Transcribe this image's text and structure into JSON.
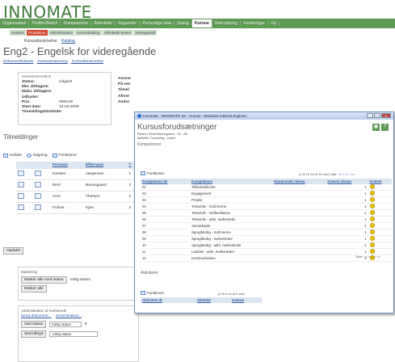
{
  "app": {
    "logo": "INNOMATE"
  },
  "mainnav": [
    "Organisation",
    "Profiler/Match",
    "Kompetencer",
    "Aktiviteter",
    "Rapporter",
    "Personlige data",
    "Dialog",
    "Kursus",
    "Rekruttering",
    "Vurderinger",
    "Op"
  ],
  "mainnav_active": "Kursus",
  "subnav": [
    "Analyse",
    "Produktion",
    "Administration",
    "Kursuskatalog",
    "Afsluttede kurser",
    "Ventegekald"
  ],
  "subnav_active": "Produktion",
  "crumbs": {
    "current": "Kursusbeskrivelse",
    "link": "Katalog"
  },
  "page": {
    "title": "Eng2 - Engelsk for videregående",
    "links": [
      "Dokumenthistorie",
      "Kursusevaluering",
      "Kursusbeskrivelse"
    ]
  },
  "info": {
    "legend": "Kursusinformation",
    "rows": [
      {
        "label": "Status:",
        "value": "Udgivet"
      },
      {
        "label": "Min. deltagere:",
        "value": ""
      },
      {
        "label": "Maks. deltagere:",
        "value": ""
      },
      {
        "label": "Udbyder:",
        "value": ""
      },
      {
        "label": "Pris:",
        "value": "2000,50"
      },
      {
        "label": "Start dato:",
        "value": "12-02-2009"
      },
      {
        "label": "Timeoldings/Institute:",
        "value": ""
      }
    ],
    "right": [
      "Ansvar",
      "På ven",
      "Tilmel",
      "Afrest",
      "Andre"
    ]
  },
  "timeslots": {
    "title": "Tilmeldinger",
    "toolbar": [
      "Indsæt",
      "Søgning",
      "Funktioner"
    ],
    "headers": [
      "",
      "",
      "Fornavn",
      "Efternavn",
      "T"
    ],
    "rows": [
      [
        "Karsten",
        "Jørgensen",
        "1"
      ],
      [
        "Bent",
        "Baunsgaard",
        "2"
      ],
      [
        "Anni",
        "Thorsen",
        "1"
      ],
      [
        "Folmer",
        "Kjær",
        "2"
      ]
    ],
    "update": "Opdatér"
  },
  "marking": {
    "legend": "Markering",
    "btn1": "Markér alle med status",
    "status": "Vælg status",
    "btn2": "Markér alle"
  },
  "admin": {
    "legend": "Administration af markerede",
    "links": [
      "Send dokument...",
      "Send besked..."
    ],
    "set_status": "Sæt status",
    "status": "Vælg status",
    "delete": "Slet/Afbryd",
    "status2": "Vælg status"
  },
  "popup": {
    "title": "Innomate - INNOMATE a/s - Kursus - Windows Internet Explorer",
    "heading": "Kursusforudsætninger",
    "sub1": "Person: Bent Baunsgaard - 26 - 88",
    "sub2": "Aktivitet: Coaching - coach",
    "section1": "Kompetencer",
    "functions": "Funktioner",
    "info_top": "(1 til 15 ud af 15 vist) Side:",
    "pager_top": "<< < 1 > >>",
    "headers": [
      "Kompetence ID",
      "",
      "Kompetence",
      "Nuværende niveau",
      "Krævet niveau",
      "Krævet"
    ],
    "rows": [
      [
        "01",
        "Tilfredsstillende",
        "1"
      ],
      [
        "02",
        "Engagement",
        "1"
      ],
      [
        "03",
        "Projekt",
        "1"
      ],
      [
        "04",
        "Teksebile - SUD-kerne",
        "1"
      ],
      [
        "05",
        "Teksebile - mellemklasse",
        "1"
      ],
      [
        "06",
        "Teksebile - adm. mellemlede",
        "1"
      ],
      [
        "07",
        "Samarbejde",
        "1"
      ],
      [
        "08",
        "Sprogfærdig - SUD-kerne",
        "1"
      ],
      [
        "09",
        "Sprogfærdig - mellemleder",
        "1"
      ],
      [
        "10",
        "Sprogfærdig - adm. mellemleder",
        "1"
      ],
      [
        "11",
        "Ledelse - adm. mellemleder",
        "1"
      ],
      [
        "12",
        "Kommunikation",
        "1"
      ]
    ],
    "pager_bottom": "Side: << < 1 > >>",
    "section2": "Aktiviteter",
    "functions2": "Funktioner",
    "info_bottom": "(0 til 0 ud af 0 vist)",
    "headers2": [
      "Aktivitets ID",
      "",
      "Aktivitet",
      "Krævet"
    ]
  }
}
